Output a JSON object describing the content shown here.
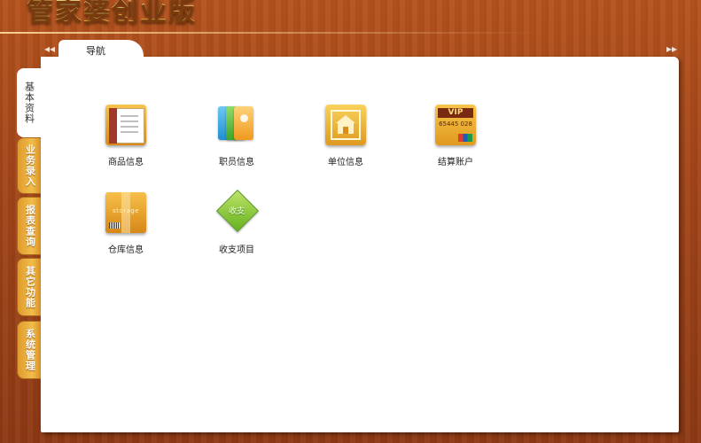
{
  "app": {
    "title": "管家婆创业版"
  },
  "nav": {
    "tab_label": "导航",
    "collapse_left": "◂◂",
    "collapse_right": "▸▸"
  },
  "side_tabs": [
    {
      "label": "基本资料",
      "active": true
    },
    {
      "label": "业务录入",
      "active": false
    },
    {
      "label": "报表查询",
      "active": false
    },
    {
      "label": "其它功能",
      "active": false
    },
    {
      "label": "系统管理",
      "active": false
    }
  ],
  "tiles": [
    {
      "label": "商品信息",
      "icon": "product-info-icon"
    },
    {
      "label": "职员信息",
      "icon": "staff-info-icon"
    },
    {
      "label": "单位信息",
      "icon": "unit-info-icon"
    },
    {
      "label": "结算账户",
      "icon": "settlement-account-icon"
    },
    {
      "label": "仓库信息",
      "icon": "warehouse-info-icon"
    },
    {
      "label": "收支项目",
      "icon": "income-expense-icon"
    }
  ],
  "icon_text": {
    "goods_spine": "COMPANY",
    "vip_label": "VIP",
    "vip_number": "65445 028",
    "storage_label": "storage",
    "diamond_label": "收支"
  },
  "colors": {
    "wood_background": "#a4461a",
    "tab_gold": "#f1bd4a",
    "panel": "#ffffff"
  }
}
